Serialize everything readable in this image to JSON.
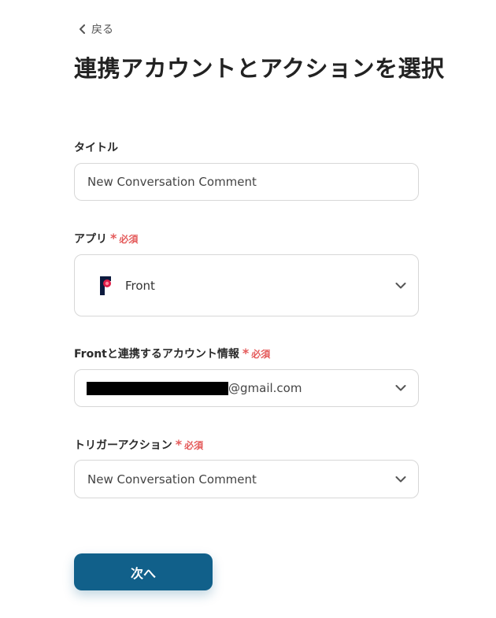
{
  "back_label": "戻る",
  "page_title": "連携アカウントとアクションを選択",
  "title_field": {
    "label": "タイトル",
    "value": "New Conversation Comment"
  },
  "app_field": {
    "label": "アプリ",
    "required_label": "必須",
    "selected_app": "Front",
    "app_icon": "front-logo-icon"
  },
  "account_field": {
    "label": "Frontと連携するアカウント情報",
    "required_label": "必須",
    "email_suffix": "@gmail.com"
  },
  "trigger_field": {
    "label": "トリガーアクション",
    "required_label": "必須",
    "value": "New Conversation Comment"
  },
  "next_button": "次へ",
  "colors": {
    "primary": "#11608a",
    "required": "#e45a5a",
    "border": "#d7d7d7"
  }
}
